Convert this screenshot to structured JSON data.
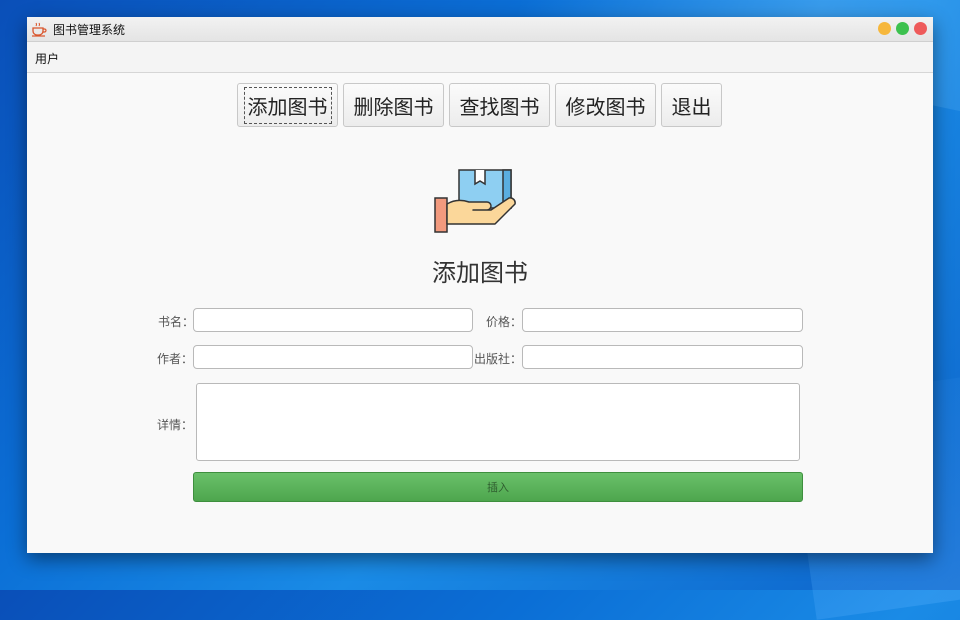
{
  "window": {
    "title": "图书管理系统",
    "app_icon": "coffee-cup-icon"
  },
  "menubar": {
    "items": [
      {
        "label": "用户"
      }
    ]
  },
  "toolbar": {
    "buttons": [
      {
        "label": "添加图书",
        "focused": true
      },
      {
        "label": "删除图书"
      },
      {
        "label": "查找图书"
      },
      {
        "label": "修改图书"
      },
      {
        "label": "退出"
      }
    ]
  },
  "hero": {
    "icon": "hand-holding-book-icon"
  },
  "page_title": "添加图书",
  "form": {
    "name_label": "书名：",
    "name_value": "",
    "price_label": "价格：",
    "price_value": "",
    "author_label": "作者：",
    "author_value": "",
    "publisher_label": "出版社：",
    "publisher_value": "",
    "details_label": "详情：",
    "details_value": "",
    "submit_label": "插入"
  },
  "colors": {
    "submit": "#5cb35c",
    "desktop": "#0b6fd6"
  }
}
